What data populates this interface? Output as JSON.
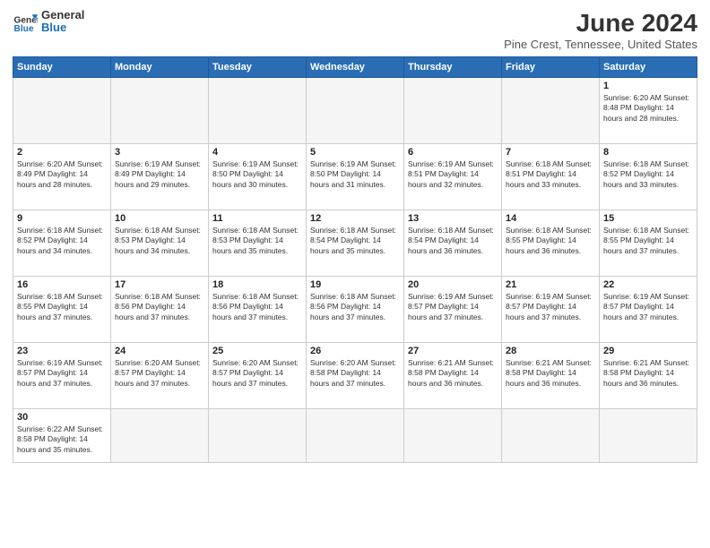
{
  "header": {
    "logo_general": "General",
    "logo_blue": "Blue",
    "title": "June 2024",
    "subtitle": "Pine Crest, Tennessee, United States"
  },
  "weekdays": [
    "Sunday",
    "Monday",
    "Tuesday",
    "Wednesday",
    "Thursday",
    "Friday",
    "Saturday"
  ],
  "weeks": [
    [
      {
        "day": "",
        "info": ""
      },
      {
        "day": "",
        "info": ""
      },
      {
        "day": "",
        "info": ""
      },
      {
        "day": "",
        "info": ""
      },
      {
        "day": "",
        "info": ""
      },
      {
        "day": "",
        "info": ""
      },
      {
        "day": "1",
        "info": "Sunrise: 6:20 AM\nSunset: 8:48 PM\nDaylight: 14 hours\nand 28 minutes."
      }
    ],
    [
      {
        "day": "2",
        "info": "Sunrise: 6:20 AM\nSunset: 8:49 PM\nDaylight: 14 hours\nand 28 minutes."
      },
      {
        "day": "3",
        "info": "Sunrise: 6:19 AM\nSunset: 8:49 PM\nDaylight: 14 hours\nand 29 minutes."
      },
      {
        "day": "4",
        "info": "Sunrise: 6:19 AM\nSunset: 8:50 PM\nDaylight: 14 hours\nand 30 minutes."
      },
      {
        "day": "5",
        "info": "Sunrise: 6:19 AM\nSunset: 8:50 PM\nDaylight: 14 hours\nand 31 minutes."
      },
      {
        "day": "6",
        "info": "Sunrise: 6:19 AM\nSunset: 8:51 PM\nDaylight: 14 hours\nand 32 minutes."
      },
      {
        "day": "7",
        "info": "Sunrise: 6:18 AM\nSunset: 8:51 PM\nDaylight: 14 hours\nand 33 minutes."
      },
      {
        "day": "8",
        "info": "Sunrise: 6:18 AM\nSunset: 8:52 PM\nDaylight: 14 hours\nand 33 minutes."
      }
    ],
    [
      {
        "day": "9",
        "info": "Sunrise: 6:18 AM\nSunset: 8:52 PM\nDaylight: 14 hours\nand 34 minutes."
      },
      {
        "day": "10",
        "info": "Sunrise: 6:18 AM\nSunset: 8:53 PM\nDaylight: 14 hours\nand 34 minutes."
      },
      {
        "day": "11",
        "info": "Sunrise: 6:18 AM\nSunset: 8:53 PM\nDaylight: 14 hours\nand 35 minutes."
      },
      {
        "day": "12",
        "info": "Sunrise: 6:18 AM\nSunset: 8:54 PM\nDaylight: 14 hours\nand 35 minutes."
      },
      {
        "day": "13",
        "info": "Sunrise: 6:18 AM\nSunset: 8:54 PM\nDaylight: 14 hours\nand 36 minutes."
      },
      {
        "day": "14",
        "info": "Sunrise: 6:18 AM\nSunset: 8:55 PM\nDaylight: 14 hours\nand 36 minutes."
      },
      {
        "day": "15",
        "info": "Sunrise: 6:18 AM\nSunset: 8:55 PM\nDaylight: 14 hours\nand 37 minutes."
      }
    ],
    [
      {
        "day": "16",
        "info": "Sunrise: 6:18 AM\nSunset: 8:55 PM\nDaylight: 14 hours\nand 37 minutes."
      },
      {
        "day": "17",
        "info": "Sunrise: 6:18 AM\nSunset: 8:56 PM\nDaylight: 14 hours\nand 37 minutes."
      },
      {
        "day": "18",
        "info": "Sunrise: 6:18 AM\nSunset: 8:56 PM\nDaylight: 14 hours\nand 37 minutes."
      },
      {
        "day": "19",
        "info": "Sunrise: 6:18 AM\nSunset: 8:56 PM\nDaylight: 14 hours\nand 37 minutes."
      },
      {
        "day": "20",
        "info": "Sunrise: 6:19 AM\nSunset: 8:57 PM\nDaylight: 14 hours\nand 37 minutes."
      },
      {
        "day": "21",
        "info": "Sunrise: 6:19 AM\nSunset: 8:57 PM\nDaylight: 14 hours\nand 37 minutes."
      },
      {
        "day": "22",
        "info": "Sunrise: 6:19 AM\nSunset: 8:57 PM\nDaylight: 14 hours\nand 37 minutes."
      }
    ],
    [
      {
        "day": "23",
        "info": "Sunrise: 6:19 AM\nSunset: 8:57 PM\nDaylight: 14 hours\nand 37 minutes."
      },
      {
        "day": "24",
        "info": "Sunrise: 6:20 AM\nSunset: 8:57 PM\nDaylight: 14 hours\nand 37 minutes."
      },
      {
        "day": "25",
        "info": "Sunrise: 6:20 AM\nSunset: 8:57 PM\nDaylight: 14 hours\nand 37 minutes."
      },
      {
        "day": "26",
        "info": "Sunrise: 6:20 AM\nSunset: 8:58 PM\nDaylight: 14 hours\nand 37 minutes."
      },
      {
        "day": "27",
        "info": "Sunrise: 6:21 AM\nSunset: 8:58 PM\nDaylight: 14 hours\nand 36 minutes."
      },
      {
        "day": "28",
        "info": "Sunrise: 6:21 AM\nSunset: 8:58 PM\nDaylight: 14 hours\nand 36 minutes."
      },
      {
        "day": "29",
        "info": "Sunrise: 6:21 AM\nSunset: 8:58 PM\nDaylight: 14 hours\nand 36 minutes."
      }
    ],
    [
      {
        "day": "30",
        "info": "Sunrise: 6:22 AM\nSunset: 8:58 PM\nDaylight: 14 hours\nand 35 minutes."
      },
      {
        "day": "",
        "info": ""
      },
      {
        "day": "",
        "info": ""
      },
      {
        "day": "",
        "info": ""
      },
      {
        "day": "",
        "info": ""
      },
      {
        "day": "",
        "info": ""
      },
      {
        "day": "",
        "info": ""
      }
    ]
  ]
}
